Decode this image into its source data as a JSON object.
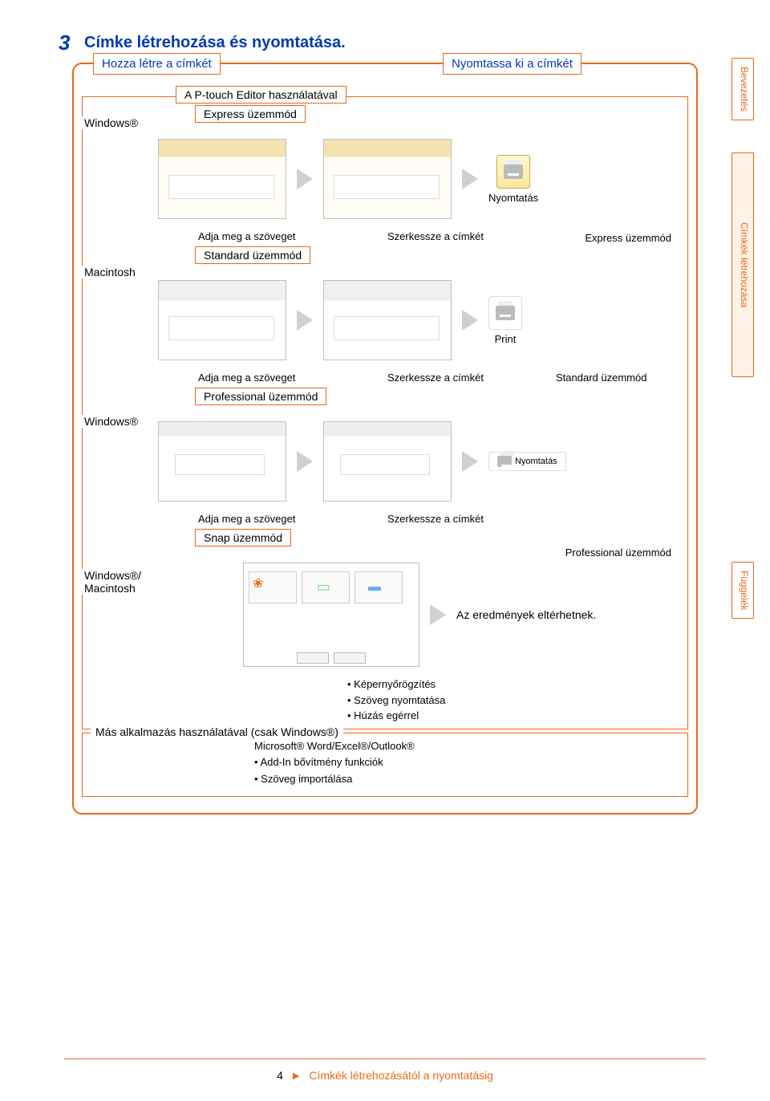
{
  "section": {
    "number": "3",
    "title": "Címke létrehozása és nyomtatása."
  },
  "top_tags": {
    "create": "Hozza létre a címkét",
    "print": "Nyomtassa ki a címkét"
  },
  "side_tabs": {
    "intro": "Bevezetés",
    "labels": "Címkék létrehozása",
    "appendix": "Függelék"
  },
  "box1": {
    "ptouch": "A P-touch Editor használatával",
    "os_win": "Windows®",
    "mode_express": "Express üzemmód",
    "mode_print_express": "Express üzemmód",
    "print_label_nyom": "Nyomtatás",
    "os_mac": "Macintosh",
    "text_label": "Adja meg a szöveget",
    "edit_label": "Szerkessze a címkét",
    "mode_standard": "Standard üzemmód",
    "mode_print_standard": "Standard üzemmód",
    "print_mac": "Print",
    "os_win2": "Windows®",
    "mode_professional": "Professional üzemmód",
    "mode_print_professional": "Professional üzemmód",
    "print_label_pro": "Nyomtatás",
    "os_winmac": "Windows®/ Macintosh",
    "mode_snap": "Snap üzemmód",
    "results_text": "Az eredmények eltérhetnek.",
    "bullets": {
      "b1": "• Képernyőrögzítés",
      "b2": "• Szöveg nyomtatása",
      "b3": "• Húzás egérrel"
    }
  },
  "box2": {
    "head": "Más alkalmazás használatával (csak Windows®)",
    "line1": "Microsoft® Word/Excel®/Outlook®",
    "line2": "• Add-In bővítmény funkciók",
    "line3": "• Szöveg importálása"
  },
  "footer": {
    "page": "4",
    "text": "Címkék létrehozásától a nyomtatásig"
  }
}
